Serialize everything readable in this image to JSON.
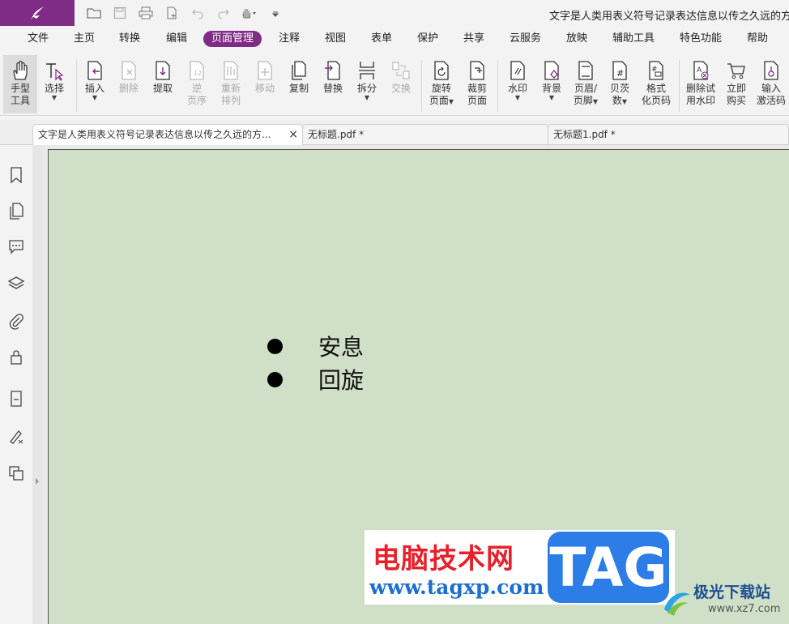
{
  "window": {
    "title": "文字是人类用表义符号记录表达信息以传之久远的方式和"
  },
  "menu": [
    {
      "label": "文件",
      "active": false
    },
    {
      "label": "主页",
      "active": false
    },
    {
      "label": "转换",
      "active": false
    },
    {
      "label": "编辑",
      "active": false
    },
    {
      "label": "页面管理",
      "active": true
    },
    {
      "label": "注释",
      "active": false
    },
    {
      "label": "视图",
      "active": false
    },
    {
      "label": "表单",
      "active": false
    },
    {
      "label": "保护",
      "active": false
    },
    {
      "label": "共享",
      "active": false
    },
    {
      "label": "云服务",
      "active": false
    },
    {
      "label": "放映",
      "active": false
    },
    {
      "label": "辅助工具",
      "active": false
    },
    {
      "label": "特色功能",
      "active": false
    },
    {
      "label": "帮助",
      "active": false
    }
  ],
  "ribbon": [
    {
      "l1": "手型",
      "l2": "工具",
      "icon": "hand-icon"
    },
    {
      "l1": "选择",
      "l2": "",
      "icon": "select-text-icon",
      "caret": true
    },
    {
      "l1": "插入",
      "l2": "",
      "icon": "insert-page-icon",
      "caret": true
    },
    {
      "l1": "删除",
      "l2": "",
      "icon": "delete-page-icon",
      "disabled": true
    },
    {
      "l1": "提取",
      "l2": "",
      "icon": "extract-page-icon"
    },
    {
      "l1": "逆",
      "l2": "页序",
      "icon": "reverse-pages-icon",
      "disabled": true
    },
    {
      "l1": "重新",
      "l2": "排列",
      "icon": "rearrange-icon",
      "disabled": true
    },
    {
      "l1": "移动",
      "l2": "",
      "icon": "move-page-icon",
      "disabled": true
    },
    {
      "l1": "复制",
      "l2": "",
      "icon": "copy-page-icon"
    },
    {
      "l1": "替换",
      "l2": "",
      "icon": "replace-page-icon"
    },
    {
      "l1": "拆分",
      "l2": "",
      "icon": "split-icon",
      "caret": true
    },
    {
      "l1": "交换",
      "l2": "",
      "icon": "swap-icon",
      "disabled": true
    },
    {
      "l1": "旋转",
      "l2": "页面",
      "icon": "rotate-page-icon",
      "caret": true
    },
    {
      "l1": "裁剪",
      "l2": "页面",
      "icon": "crop-page-icon"
    },
    {
      "l1": "水印",
      "l2": "",
      "icon": "watermark-icon",
      "caret": true
    },
    {
      "l1": "背景",
      "l2": "",
      "icon": "background-icon",
      "caret": true
    },
    {
      "l1": "页眉/",
      "l2": "页脚",
      "icon": "header-footer-icon",
      "caret": true
    },
    {
      "l1": "贝茨",
      "l2": "数",
      "icon": "bates-icon",
      "caret": true
    },
    {
      "l1": "格式",
      "l2": "化页码",
      "icon": "page-number-icon"
    },
    {
      "l1": "删除试",
      "l2": "用水印",
      "icon": "remove-trial-watermark-icon"
    },
    {
      "l1": "立即",
      "l2": "购买",
      "icon": "cart-icon"
    },
    {
      "l1": "输入",
      "l2": "激活码",
      "icon": "key-icon"
    }
  ],
  "tabs": [
    {
      "label": "文字是人类用表义符号记录表达信息以传之久远的方...",
      "active": true,
      "close": "×"
    },
    {
      "label": "无标题.pdf *",
      "active": false
    },
    {
      "label": "无标题1.pdf *",
      "active": false
    }
  ],
  "document": {
    "bullets": [
      "安息",
      "回旋"
    ]
  },
  "watermark": {
    "cn": "电脑技术网",
    "url": "www.tagxp.com",
    "tag": "TAG",
    "site2": "极光下载站",
    "site2_url": "www.xz7.com"
  },
  "colors": {
    "brand": "#7e2c86",
    "page_bg": "#d0dfc7"
  }
}
